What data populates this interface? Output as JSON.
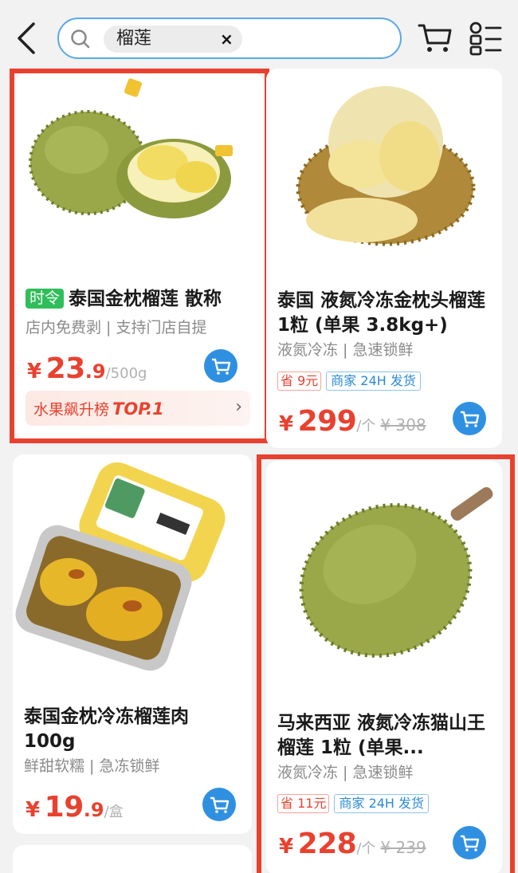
{
  "search": {
    "chip_text": "榴莲",
    "chip_close": "×"
  },
  "colors": {
    "accent": "#e9412f",
    "blue": "#2f90e2",
    "green_tag": "#2fbe5a"
  },
  "products": [
    {
      "tag": "时令",
      "title": "泰国金枕榴莲 散称",
      "subtitle": "店内免费剥 | 支持门店自提",
      "currency": "¥",
      "price_int": "23",
      "price_dec": ".9",
      "unit": "/500g",
      "rank_label": "水果飙升榜",
      "rank_top": "TOP.1",
      "rank_arrow": "›"
    },
    {
      "title": "泰国 液氮冷冻金枕头榴莲 1粒 (单果 3.8kg+)",
      "subtitle": "液氮冷冻 | 急速锁鲜",
      "save_label": "省",
      "save_value": "9元",
      "ship_label": "商家 24H 发货",
      "currency": "¥",
      "price_int": "299",
      "unit": "/个",
      "orig": "¥ 308"
    },
    {
      "title": "泰国金枕冷冻榴莲肉 100g",
      "subtitle": "鲜甜软糯 | 急冻锁鲜",
      "currency": "¥",
      "price_int": "19",
      "price_dec": ".9",
      "unit": "/盒"
    },
    {
      "title": "马来西亚 液氮冷冻猫山王榴莲 1粒 (单果...",
      "subtitle": "液氮冷冻 | 急速锁鲜",
      "save_label": "省",
      "save_value": "11元",
      "ship_label": "商家 24H 发货",
      "currency": "¥",
      "price_int": "228",
      "unit": "/个",
      "orig": "¥ 239"
    }
  ]
}
